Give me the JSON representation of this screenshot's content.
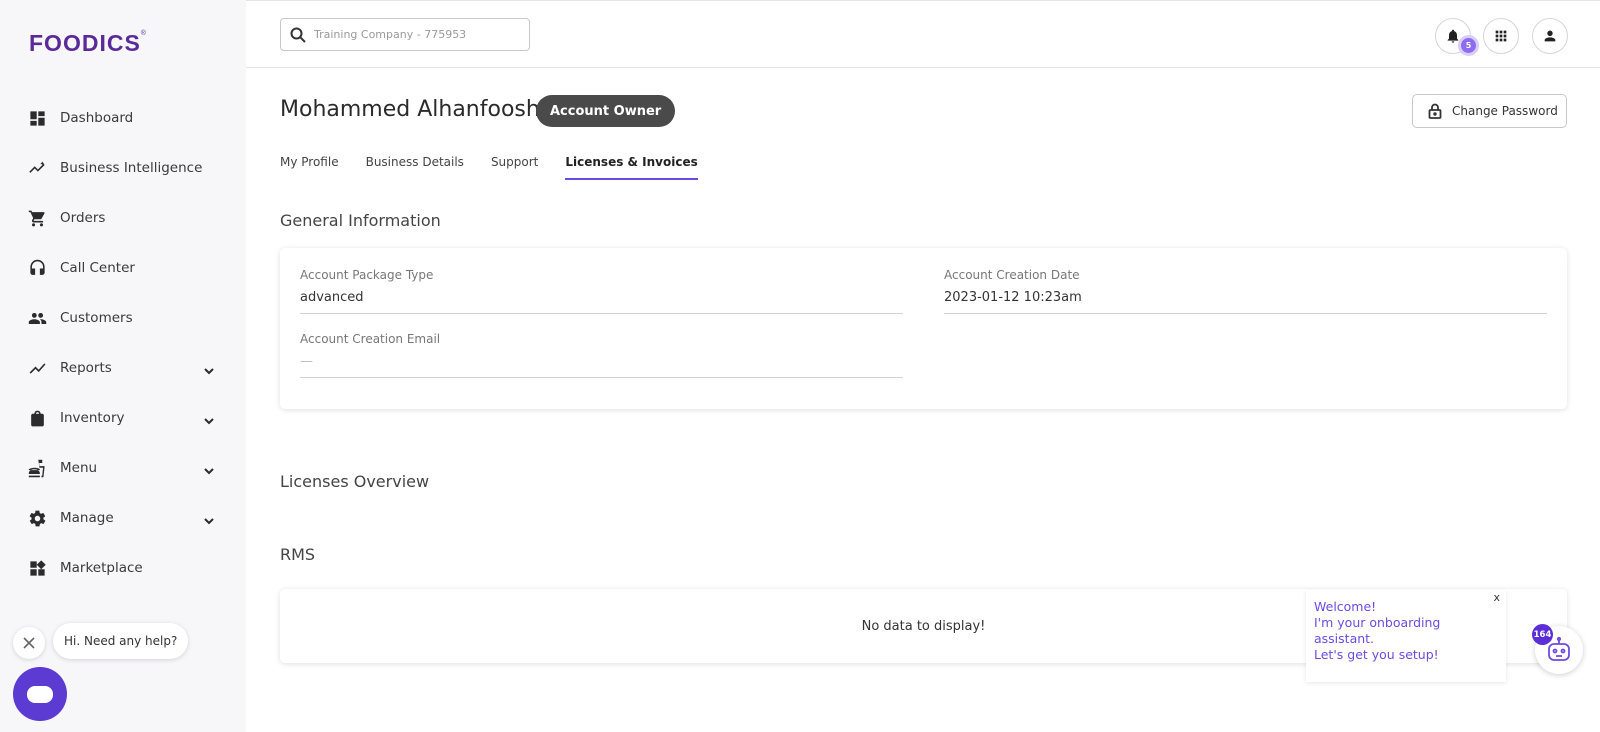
{
  "brand": {
    "logo_text": "FOODICS",
    "logo_mark": "®"
  },
  "sidebar": {
    "items": [
      {
        "label": "Dashboard",
        "icon": "dashboard-icon",
        "expandable": false
      },
      {
        "label": "Business Intelligence",
        "icon": "insights-icon",
        "expandable": false
      },
      {
        "label": "Orders",
        "icon": "cart-icon",
        "expandable": false
      },
      {
        "label": "Call Center",
        "icon": "headset-icon",
        "expandable": false
      },
      {
        "label": "Customers",
        "icon": "people-icon",
        "expandable": false
      },
      {
        "label": "Reports",
        "icon": "trending-icon",
        "expandable": true
      },
      {
        "label": "Inventory",
        "icon": "bag-icon",
        "expandable": true
      },
      {
        "label": "Menu",
        "icon": "food-icon",
        "expandable": true
      },
      {
        "label": "Manage",
        "icon": "gear-icon",
        "expandable": true
      },
      {
        "label": "Marketplace",
        "icon": "widgets-icon",
        "expandable": false
      }
    ]
  },
  "help": {
    "bubble_text": "Hi. Need any help?"
  },
  "topbar": {
    "search_placeholder": "Training Company - 775953",
    "notification_count": "5"
  },
  "profile": {
    "name": "Mohammed Alhanfoosh",
    "role_badge": "Account Owner",
    "change_password_label": "Change Password"
  },
  "tabs": [
    {
      "label": "My Profile",
      "active": false
    },
    {
      "label": "Business Details",
      "active": false
    },
    {
      "label": "Support",
      "active": false
    },
    {
      "label": "Licenses & Invoices",
      "active": true
    }
  ],
  "general": {
    "heading": "General Information",
    "package_type_label": "Account Package Type",
    "package_type_value": "advanced",
    "creation_date_label": "Account Creation Date",
    "creation_date_value": "2023-01-12 10:23am",
    "creation_email_label": "Account Creation Email",
    "creation_email_value": "—"
  },
  "licenses": {
    "heading": "Licenses Overview"
  },
  "rms": {
    "heading": "RMS",
    "empty_text": "No data to display!"
  },
  "onboarding": {
    "close": "x",
    "line1": "Welcome!",
    "line2": "I'm your onboarding assistant.",
    "line3": "Let's get you setup!",
    "badge_count": "164"
  },
  "colors": {
    "accent": "#6b4ce0",
    "brand": "#5b2a9a",
    "badge_dark": "#4a4a4a"
  }
}
